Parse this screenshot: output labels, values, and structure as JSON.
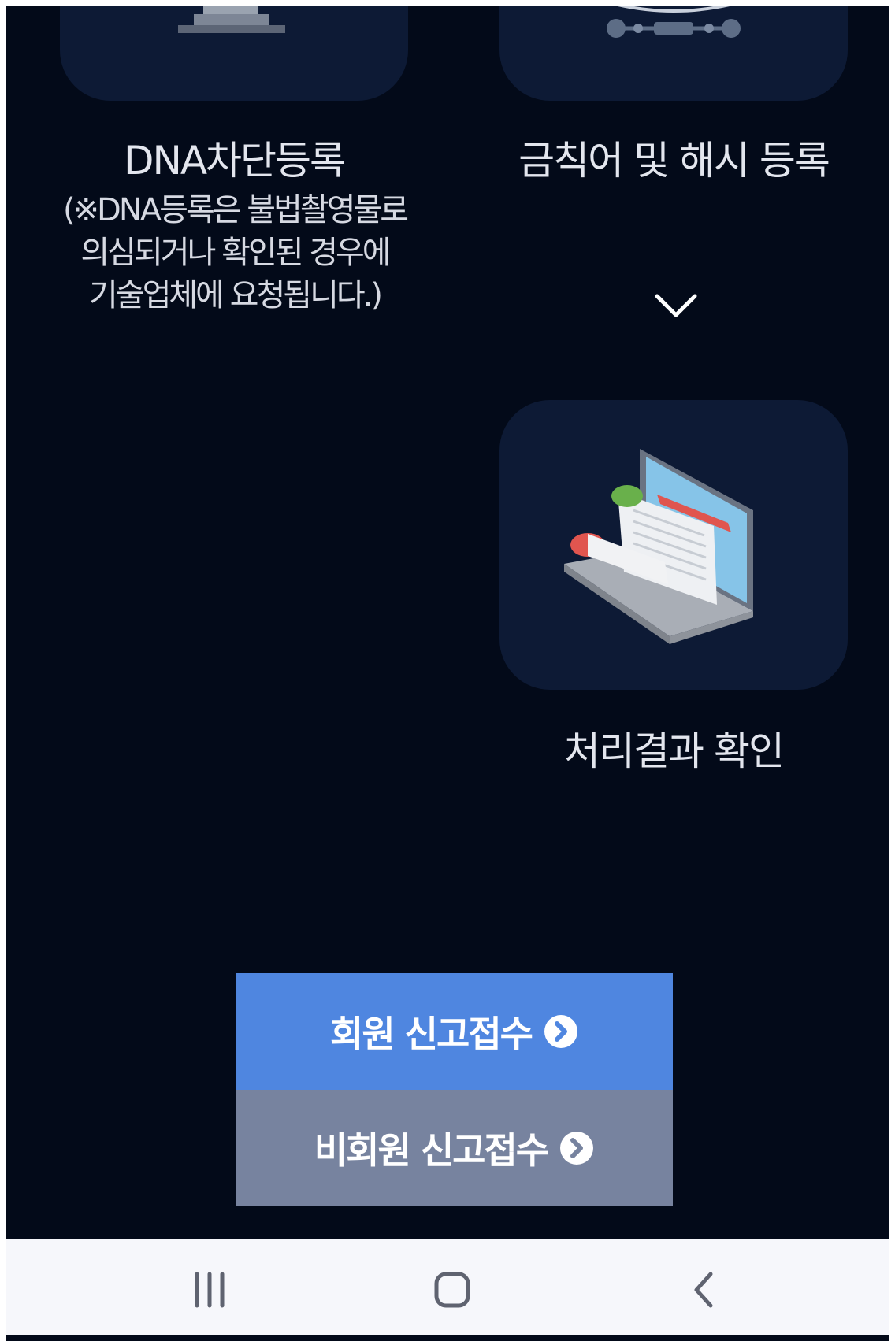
{
  "steps": {
    "dna": {
      "title": "DNA차단등록",
      "note_lines": [
        "(※DNA등록은 불법촬영물로",
        "의심되거나 확인된 경우에",
        "기술업체에 요청됩니다.)"
      ],
      "icon": "monitor-stand-icon"
    },
    "keyword": {
      "title": "금칙어 및 해시 등록",
      "icon": "network-hub-icon"
    },
    "result": {
      "title": "처리결과 확인",
      "icon": "laptop-document-icon"
    }
  },
  "flow_icon": "chevron-down-icon",
  "buttons": {
    "member_label": "회원 신고접수",
    "nonmember_label": "비회원 신고접수",
    "member_color": "#4f86e0",
    "nonmember_color": "#77839f",
    "arrow_icon": "circle-chevron-right-icon"
  },
  "colors": {
    "background": "#030a19",
    "card": "#0d1a35",
    "navbar": "#f6f7fb"
  },
  "navbar": {
    "icons": [
      "recent-apps-icon",
      "home-icon",
      "back-icon"
    ]
  }
}
